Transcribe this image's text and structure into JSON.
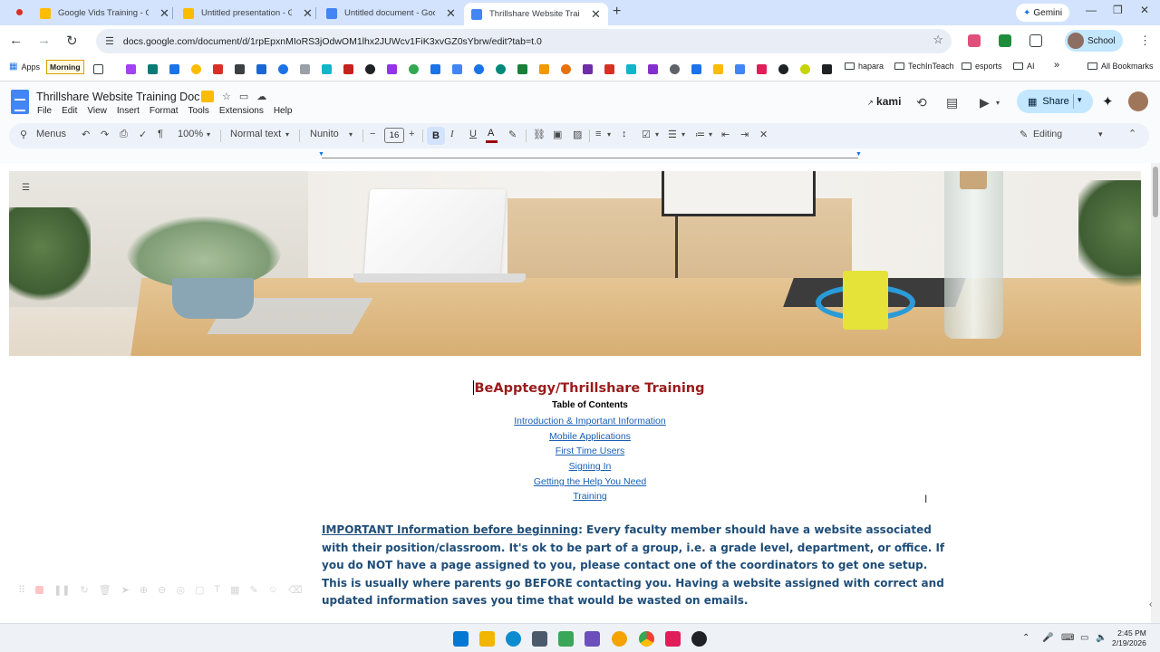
{
  "browser": {
    "tabs": [
      {
        "label": "Google Vids Training - Goog",
        "color": "#fbbc04"
      },
      {
        "label": "Untitled presentation - Goo",
        "color": "#fbbc04"
      },
      {
        "label": "Untitled document - Google",
        "color": "#4285f4"
      },
      {
        "label": "Thrillshare Website Training",
        "color": "#4285f4"
      }
    ],
    "gemini_label": "Gemini",
    "url": "docs.google.com/document/d/1rpEpxnMIoRS3jOdwOM1lhx2JUWcv1FiK3xvGZ0sYbrw/edit?tab=t.0",
    "profile_label": "School"
  },
  "bookmarks": {
    "apps": "Apps",
    "morning": "Morning",
    "folders": [
      "hapara",
      "TechInTeach",
      "esports",
      "AI"
    ],
    "all": "All Bookmarks"
  },
  "docs": {
    "title": "Thrillshare Website Training Doc",
    "menus": [
      "File",
      "Edit",
      "View",
      "Insert",
      "Format",
      "Tools",
      "Extensions",
      "Help"
    ],
    "kami": "kami",
    "share": "Share"
  },
  "toolbar": {
    "search": "Menus",
    "zoom": "100%",
    "style": "Normal text",
    "font": "Nunito",
    "font_size": "16",
    "mode": "Editing"
  },
  "document": {
    "heading": "BeApptegy/Thrillshare Training",
    "toc_title": "Table of Contents",
    "toc_links": [
      "Introduction & Important Information",
      "Mobile Applications",
      "First Time Users",
      "Signing In",
      "Getting the Help You Need",
      "Training"
    ],
    "para_lead": "IMPORTANT Information before beginning",
    "para_lines": [
      ":  Every faculty member should have a website associated",
      "with their position/classroom.  It's ok to be part of a group, i.e. a grade level, department, or office.  If",
      "you do NOT have a page assigned to you, please contact one of the coordinators to get one setup.",
      "This is usually where parents go BEFORE contacting you.  Having a website assigned with correct and",
      "updated information saves you time that would be wasted on emails."
    ]
  },
  "taskbar": {
    "time": "2:45 PM",
    "date": "2/19/2026"
  }
}
